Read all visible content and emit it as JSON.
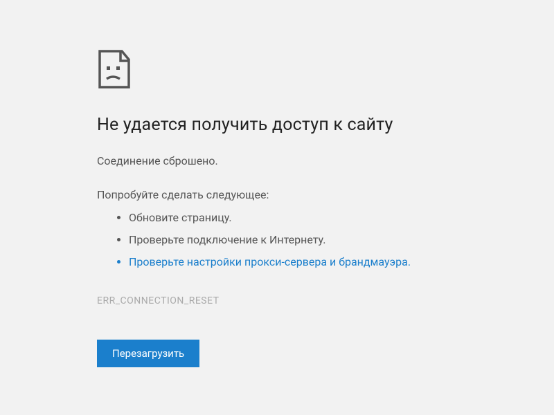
{
  "heading": "Не удается получить доступ к сайту",
  "subheading": "Соединение сброшено.",
  "try_heading": "Попробуйте сделать следующее:",
  "suggestions": {
    "item0": "Обновите страницу.",
    "item1": "Проверьте подключение к Интернету.",
    "item2": "Проверьте настройки прокси-сервера и брандмауэра."
  },
  "error_code": "ERR_CONNECTION_RESET",
  "reload_label": "Перезагрузить"
}
